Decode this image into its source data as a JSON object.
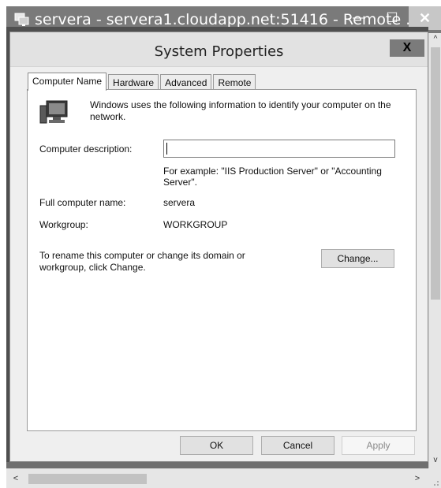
{
  "outer_window": {
    "title": "servera - servera1.cloudapp.net:51416 - Remote ...",
    "minimize_glyph": "—",
    "maximize_glyph": "☐",
    "close_glyph": "✕"
  },
  "dialog": {
    "title": "System Properties",
    "close_glyph": "X",
    "tabs": [
      {
        "label": "Computer Name",
        "active": true
      },
      {
        "label": "Hardware",
        "active": false
      },
      {
        "label": "Advanced",
        "active": false
      },
      {
        "label": "Remote",
        "active": false
      }
    ],
    "intro": "Windows uses the following information to identify your computer on the network.",
    "computer_description": {
      "label": "Computer description:",
      "value": ""
    },
    "example": "For example: \"IIS Production Server\" or \"Accounting Server\".",
    "full_computer_name": {
      "label": "Full computer name:",
      "value": "servera"
    },
    "workgroup": {
      "label": "Workgroup:",
      "value": "WORKGROUP"
    },
    "rename_text": "To rename this computer or change its domain or workgroup, click Change.",
    "buttons": {
      "change": "Change...",
      "ok": "OK",
      "cancel": "Cancel",
      "apply": "Apply"
    }
  },
  "scrollbars": {
    "up_glyph": "^",
    "down_glyph": "v",
    "left_glyph": "<",
    "right_glyph": ">"
  },
  "icons": [
    "remote-desktop-icon",
    "computer-icon",
    "size-grip-icon"
  ]
}
